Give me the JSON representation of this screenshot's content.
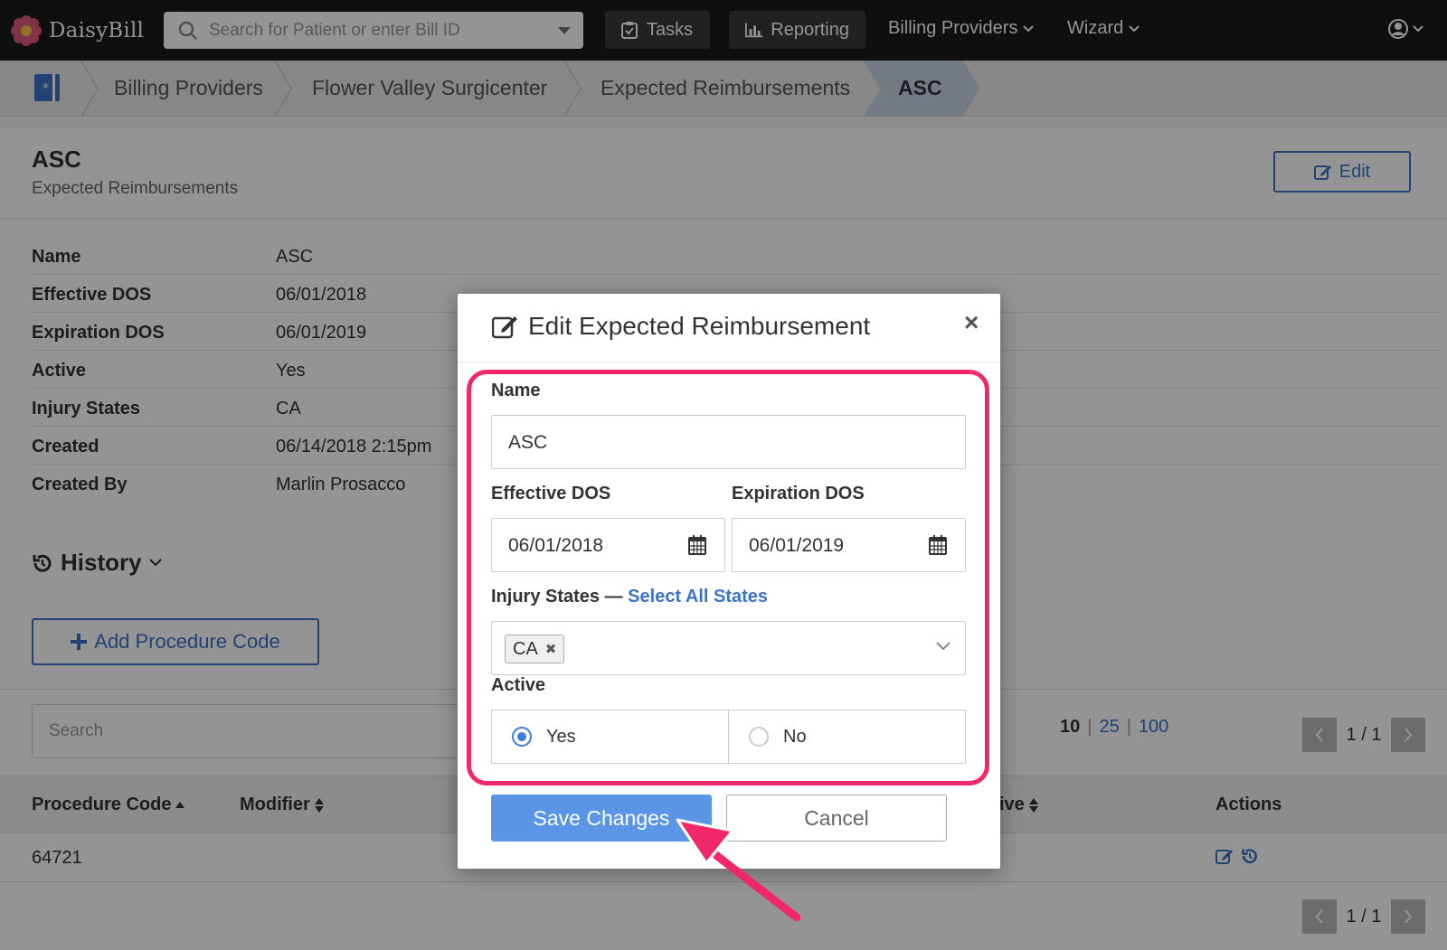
{
  "app": {
    "brand": "DaisyBill"
  },
  "topnav": {
    "search_placeholder": "Search for Patient or enter Bill ID",
    "tasks": "Tasks",
    "reporting": "Reporting",
    "billing_providers": "Billing Providers",
    "wizard": "Wizard"
  },
  "breadcrumb": {
    "items": [
      "Billing Providers",
      "Flower Valley Surgicenter",
      "Expected Reimbursements"
    ],
    "active": "ASC"
  },
  "page": {
    "title": "ASC",
    "subtitle": "Expected Reimbursements",
    "edit_label": "Edit"
  },
  "details": [
    {
      "label": "Name",
      "value": "ASC"
    },
    {
      "label": "Effective DOS",
      "value": "06/01/2018"
    },
    {
      "label": "Expiration DOS",
      "value": "06/01/2019"
    },
    {
      "label": "Active",
      "value": "Yes"
    },
    {
      "label": "Injury States",
      "value": "CA"
    },
    {
      "label": "Created",
      "value": "06/14/2018 2:15pm"
    },
    {
      "label": "Created By",
      "value": "Marlin Prosacco"
    }
  ],
  "history_label": "History",
  "add_procedure_label": "Add Procedure Code",
  "table": {
    "search_placeholder": "Search",
    "page_sizes": {
      "current": "10",
      "options": [
        "25",
        "100"
      ]
    },
    "pager_text": "1 / 1",
    "columns": [
      "Procedure Code",
      "Modifier",
      "ive",
      "Actions"
    ],
    "rows": [
      {
        "procedure_code": "64721"
      }
    ]
  },
  "modal": {
    "title": "Edit Expected Reimbursement",
    "close": "×",
    "name_label": "Name",
    "name_value": "ASC",
    "effective_label": "Effective DOS",
    "effective_value": "06/01/2018",
    "expiration_label": "Expiration DOS",
    "expiration_value": "06/01/2019",
    "injury_label": "Injury States —",
    "select_all": "Select All States",
    "injury_tags": [
      "CA"
    ],
    "active_label": "Active",
    "active_yes": "Yes",
    "active_no": "No",
    "active_selected": "Yes",
    "save_label": "Save Changes",
    "cancel_label": "Cancel"
  },
  "colors": {
    "accent": "#3b73c9",
    "highlight": "#f0286a",
    "save_button": "#5b95e6",
    "nav_bg": "#1b1b1b"
  }
}
